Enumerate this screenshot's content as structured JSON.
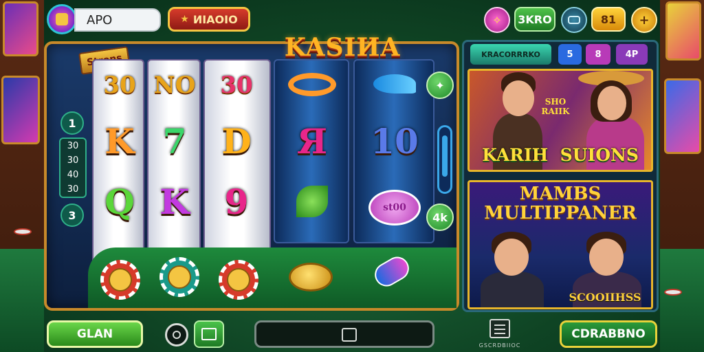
{
  "top_bar": {
    "player_name": "APO",
    "badge_label": "ИIAOIO",
    "pill_green_label": "3KRO",
    "pill_gold_label": "81",
    "plus_symbol": "+"
  },
  "title": "KASIИA",
  "machine": {
    "stars_tag": "Strons",
    "side_numbers": [
      "1",
      "3"
    ],
    "paylines": [
      "30",
      "30",
      "40",
      "30"
    ],
    "reels": [
      {
        "top": "30",
        "mid": "K",
        "bottom": "Q"
      },
      {
        "top": "NO",
        "mid": "7",
        "bottom": "K"
      },
      {
        "top": "30",
        "mid": "D",
        "bottom": "9"
      },
      {
        "top": "",
        "mid": "Я",
        "bottom": ""
      },
      {
        "top": "",
        "mid": "10",
        "bottom": "st00"
      }
    ],
    "right_buttons": [
      "✦",
      "4k",
      "▲"
    ]
  },
  "promo": {
    "tabs": [
      "KRACORRRKO",
      "5",
      "8",
      "4P"
    ],
    "card1": {
      "title": "KARIH  SUIONS",
      "sign": "SHO RAIIK"
    },
    "card2": {
      "title_line1": "MAMBS",
      "title_line2": "MULTIPPANER",
      "caption": "SCOOIIHSS"
    }
  },
  "bottom_bar": {
    "left_button": "GLAN",
    "right_button": "CDRABBNO",
    "menu_caption": "GSCRDBIIOC"
  },
  "colors": {
    "accent_green": "#2fa83a",
    "gold": "#f4c542",
    "felt": "#1e8a3c"
  }
}
